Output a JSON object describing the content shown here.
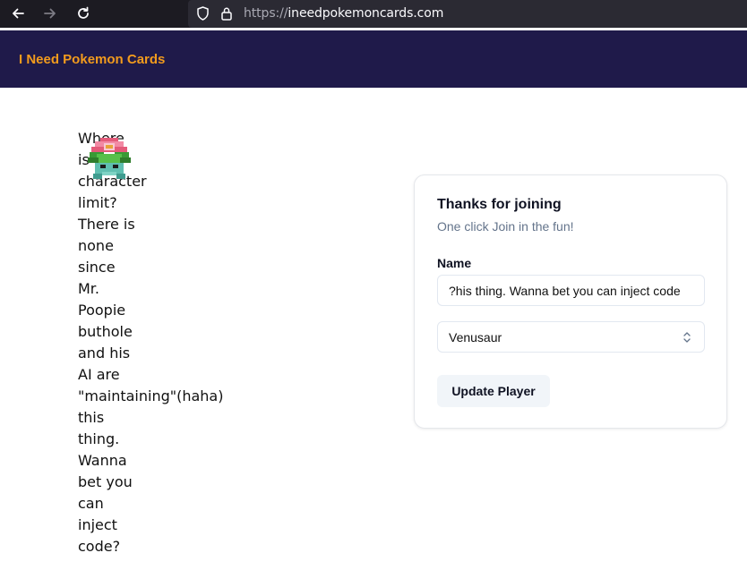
{
  "browser": {
    "url_protocol": "https://",
    "url_host": "ineedpokemoncards.com",
    "icons": [
      "back-arrow-icon",
      "forward-arrow-icon",
      "reload-icon",
      "shield-icon",
      "lock-icon"
    ]
  },
  "header": {
    "brand": "I Need Pokemon Cards",
    "brand_color": "#f29b1d",
    "background_color": "#1f1a4a"
  },
  "message": {
    "words": [
      "Where",
      "is",
      "the",
      "character",
      "limit?",
      "There is",
      "none",
      "since",
      "Mr.",
      "Poopie",
      "buthole",
      "and his",
      "AI are",
      "\"maintaining\"(haha)",
      "this",
      "thing.",
      "Wanna",
      "bet you",
      "can",
      "inject",
      "code?"
    ],
    "lines": [
      "Where",
      "is the",
      "character",
      "limit?",
      "There is",
      "none",
      "since",
      "Mr.",
      "Poopie",
      "buthole",
      "and his",
      "AI are",
      "\"maintaining\"(haha)",
      "this",
      "thing.",
      "Wanna",
      "bet you",
      "can",
      "inject",
      "code?"
    ],
    "sprite": "venusaur-sprite"
  },
  "card": {
    "title": "Thanks for joining",
    "subtitle": "One click Join in the fun!",
    "name_label": "Name",
    "name_value": "his thing. Wanna bet you can inject code?",
    "pokemon_selected": "Venusaur",
    "submit_label": "Update Player"
  }
}
